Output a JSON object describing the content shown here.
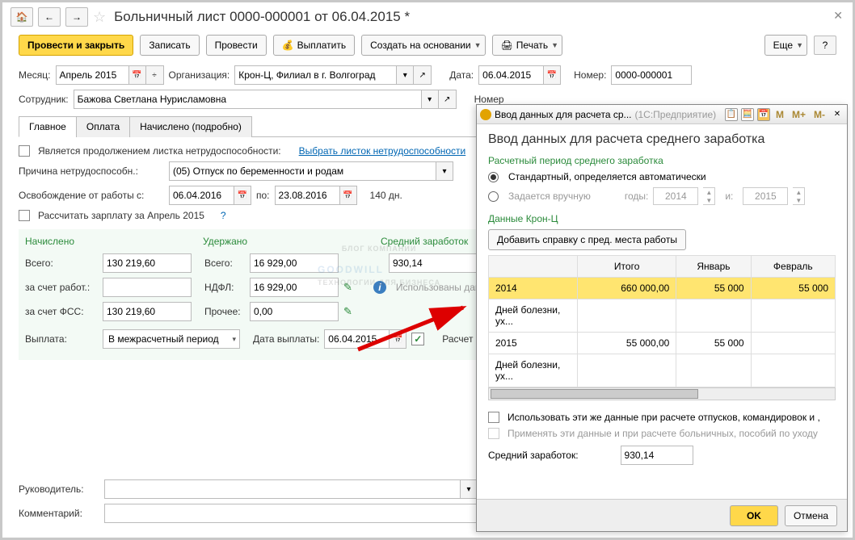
{
  "title": "Больничный лист 0000-000001 от 06.04.2015 *",
  "toolbar": {
    "post_close": "Провести и закрыть",
    "write": "Записать",
    "post": "Провести",
    "pay": "Выплатить",
    "create_based": "Создать на основании",
    "print": "Печать",
    "more": "Еще"
  },
  "header": {
    "month_lbl": "Месяц:",
    "month_val": "Апрель 2015",
    "org_lbl": "Организация:",
    "org_val": "Крон-Ц, Филиал в г. Волгоград",
    "date_lbl": "Дата:",
    "date_val": "06.04.2015",
    "num_lbl": "Номер:",
    "num_val": "0000-000001",
    "emp_lbl": "Сотрудник:",
    "emp_val": "Бажова Светлана Нурисламовна",
    "numln_lbl": "Номер"
  },
  "tabs": {
    "main": "Главное",
    "pay": "Оплата",
    "accrued": "Начислено (подробно)"
  },
  "main": {
    "continuation": "Является продолжением листка нетрудоспособности:",
    "select_sheet": "Выбрать листок нетрудоспособности",
    "reason_lbl": "Причина нетрудоспособн.:",
    "reason_val": "(05) Отпуск по беременности и родам",
    "free_lbl": "Освобождение от работы с:",
    "free_from": "06.04.2016",
    "to_lbl": "по:",
    "free_to": "23.08.2016",
    "days": "140 дн.",
    "calc_salary": "Рассчитать зарплату за Апрель 2015",
    "question": "?"
  },
  "summary": {
    "accrued_h": "Начислено",
    "withheld_h": "Удержано",
    "avg_h": "Средний заработок",
    "total_lbl": "Всего:",
    "total_accr": "130 219,60",
    "total_with": "16 929,00",
    "avg_val": "930,14",
    "emp_share_lbl": "за счет работ.:",
    "ndfl_lbl": "НДФЛ:",
    "ndfl_val": "16 929,00",
    "used_data": "Использованы данны",
    "fss_lbl": "за счет ФСС:",
    "fss_val": "130 219,60",
    "other_lbl": "Прочее:",
    "other_val": "0,00",
    "payout_lbl": "Выплата:",
    "payout_val": "В межрасчетный период",
    "paydate_lbl": "Дата выплаты:",
    "paydate_val": "06.04.2015",
    "calc_lbl": "Расчет"
  },
  "footer": {
    "manager_lbl": "Руководитель:",
    "comment_lbl": "Комментарий:"
  },
  "popup": {
    "tab_title": "Ввод данных для расчета ср...",
    "app_hint": "(1С:Предприятие)",
    "heading": "Ввод данных для расчета среднего заработка",
    "period_lbl": "Расчетный период среднего заработка",
    "std": "Стандартный, определяется автоматически",
    "manual": "Задается вручную",
    "years_lbl": "годы:",
    "year1": "2014",
    "and": "и:",
    "year2": "2015",
    "data_lbl": "Данные Крон-Ц",
    "add_ref": "Добавить справку с пред. места работы",
    "th_total": "Итого",
    "th_jan": "Январь",
    "th_feb": "Февраль",
    "row2014": "2014",
    "row2014_total": "660 000,00",
    "row2014_jan": "55 000",
    "row2014_feb": "55 000",
    "rowill": "Дней болезни, ух...",
    "row2015": "2015",
    "row2015_total": "55 000,00",
    "row2015_jan": "55 000",
    "use_same": "Использовать эти же данные при расчете отпусков, командировок и ,",
    "apply_also": "Применять эти данные и при расчете больничных, пособий по уходу",
    "avg_foot_lbl": "Средний заработок:",
    "avg_foot_val": "930,14",
    "ok": "OK",
    "cancel": "Отмена"
  },
  "watermark": {
    "big": "GOODWILL",
    "s1": "БЛОГ КОМПАНИИ",
    "s2": "ТЕХНОЛОГИИ ДЛЯ БИЗНЕСА"
  }
}
